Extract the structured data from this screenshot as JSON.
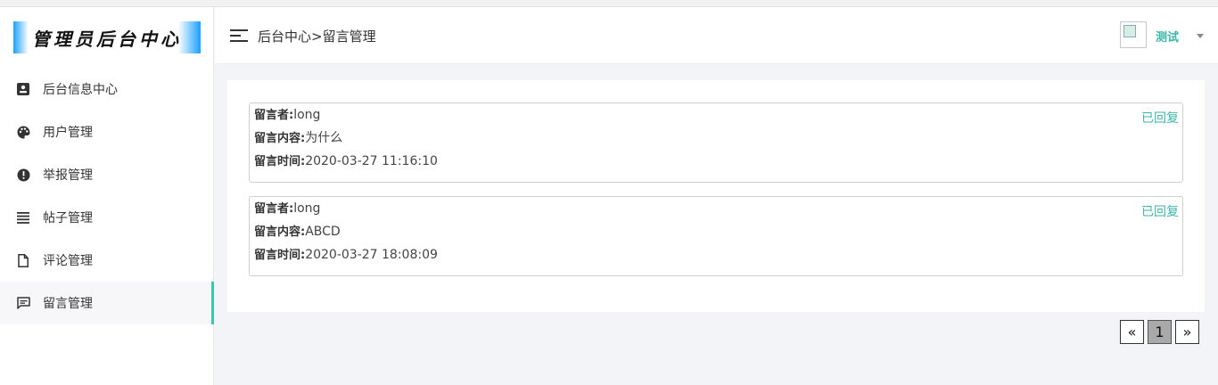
{
  "logo": {
    "text": "管理员后台中心"
  },
  "sidebar": {
    "items": [
      {
        "label": "后台信息中心",
        "icon": "id-card-icon"
      },
      {
        "label": "用户管理",
        "icon": "palette-icon"
      },
      {
        "label": "举报管理",
        "icon": "alert-circle-icon"
      },
      {
        "label": "帖子管理",
        "icon": "list-icon"
      },
      {
        "label": "评论管理",
        "icon": "file-icon"
      },
      {
        "label": "留言管理",
        "icon": "message-icon"
      }
    ],
    "active_index": 5
  },
  "header": {
    "breadcrumb": "后台中心>留言管理",
    "username": "测试"
  },
  "messages": [
    {
      "author_label": "留言者:",
      "author": "long",
      "content_label": "留言内容:",
      "content": "为什么",
      "time_label": "留言时间:",
      "time": "2020-03-27 11:16:10",
      "status": "已回复"
    },
    {
      "author_label": "留言者:",
      "author": "long",
      "content_label": "留言内容:",
      "content": "ABCD",
      "time_label": "留言时间:",
      "time": "2020-03-27 18:08:09",
      "status": "已回复"
    }
  ],
  "pagination": {
    "prev": "«",
    "current": "1",
    "next": "»"
  },
  "colors": {
    "accent": "#3cb6a8",
    "logo_blue": "#1aa0ff"
  }
}
